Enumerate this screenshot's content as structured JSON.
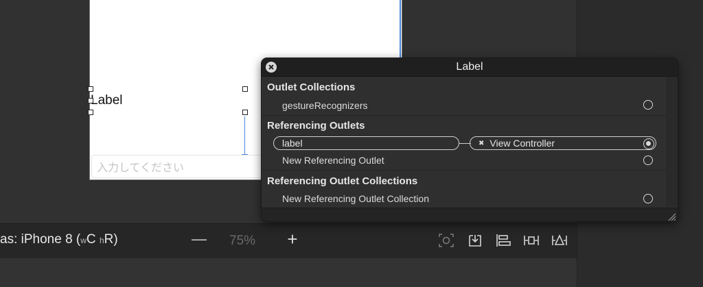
{
  "canvas": {
    "label_text": "Label",
    "textfield_placeholder": "入力してください"
  },
  "bottombar": {
    "view_as_prefix": "as: iPhone 8 (",
    "w_label": "w",
    "c_label": "C",
    "h_label": "h",
    "r_label": "R)",
    "zoom_out": "—",
    "zoom_level": "75%",
    "zoom_in": "+",
    "icons": [
      "embed-in-icon",
      "update-frames-icon",
      "align-icon",
      "add-constraints-icon",
      "resolve-layout-icon"
    ]
  },
  "popup": {
    "title": "Label",
    "sections": {
      "outlet_collections": "Outlet Collections",
      "referencing_outlets": "Referencing Outlets",
      "referencing_outlet_collections": "Referencing Outlet Collections"
    },
    "rows": {
      "gesture_recognizers": "gestureRecognizers",
      "outlet_name": "label",
      "outlet_target": "View Controller",
      "new_referencing_outlet": "New Referencing Outlet",
      "new_referencing_outlet_collection": "New Referencing Outlet Collection"
    }
  }
}
